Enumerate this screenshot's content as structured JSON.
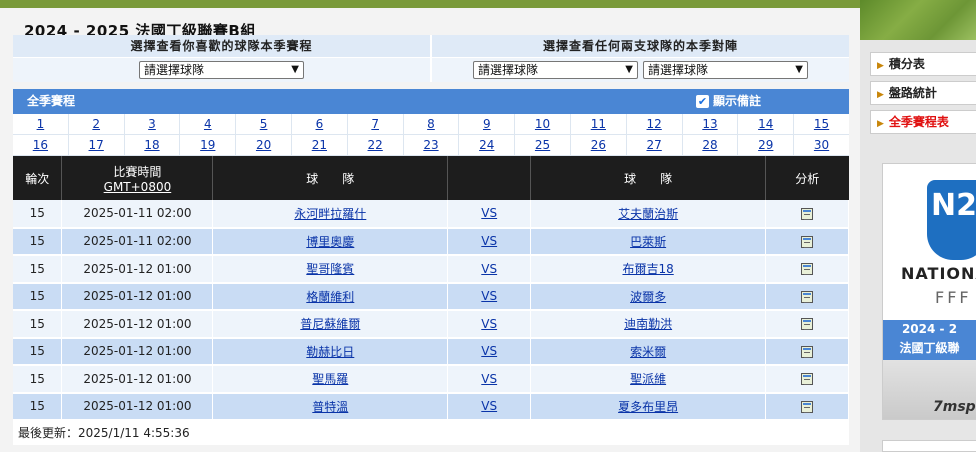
{
  "title": "2024 - 2025 法國丁級聯賽B組",
  "selectors": {
    "team_schedule_heading": "選擇查看你喜歡的球隊本季賽程",
    "matchup_heading": "選擇查看任何兩支球隊的本季對陣",
    "placeholder": "請選擇球隊"
  },
  "season": {
    "label": "全季賽程",
    "show_notes_label": "顯示備註",
    "show_notes_checked": true
  },
  "rounds_row1": [
    "1",
    "2",
    "3",
    "4",
    "5",
    "6",
    "7",
    "8",
    "9",
    "10",
    "11",
    "12",
    "13",
    "14",
    "15"
  ],
  "rounds_row2": [
    "16",
    "17",
    "18",
    "19",
    "20",
    "21",
    "22",
    "23",
    "24",
    "25",
    "26",
    "27",
    "28",
    "29",
    "30"
  ],
  "table": {
    "headers": {
      "round": "輪次",
      "time_line1": "比賽時間",
      "time_line2": "GMT+0800",
      "home": "球　　隊",
      "vs": "",
      "away": "球　　隊",
      "analysis": "分析"
    },
    "rows": [
      {
        "round": "15",
        "time": "2025-01-11 02:00",
        "home": "永河畔拉羅什",
        "vs": "VS",
        "away": "艾夫蘭治斯"
      },
      {
        "round": "15",
        "time": "2025-01-11 02:00",
        "home": "博里奧慶",
        "vs": "VS",
        "away": "巴萊斯"
      },
      {
        "round": "15",
        "time": "2025-01-12 01:00",
        "home": "聖哥隆賓",
        "vs": "VS",
        "away": "布爾吉18"
      },
      {
        "round": "15",
        "time": "2025-01-12 01:00",
        "home": "格蘭維利",
        "vs": "VS",
        "away": "波爾多"
      },
      {
        "round": "15",
        "time": "2025-01-12 01:00",
        "home": "普尼蘇維爾",
        "vs": "VS",
        "away": "迪南勤洪"
      },
      {
        "round": "15",
        "time": "2025-01-12 01:00",
        "home": "勒赫比日",
        "vs": "VS",
        "away": "索米爾"
      },
      {
        "round": "15",
        "time": "2025-01-12 01:00",
        "home": "聖馬羅",
        "vs": "VS",
        "away": "聖派維"
      },
      {
        "round": "15",
        "time": "2025-01-12 01:00",
        "home": "普特溫",
        "vs": "VS",
        "away": "夏多布里昂"
      }
    ]
  },
  "updated": "最後更新：2025/1/11 4:55:36",
  "sidebar": {
    "items": [
      {
        "label": "積分表"
      },
      {
        "label": "盤路統計"
      },
      {
        "label": "全季賽程表"
      }
    ],
    "promo": {
      "logo_text": "N2",
      "brand_line": "NATIONA",
      "fff": "FFF",
      "band_line1": "2024 - 2",
      "band_line2": "法國丁級聯",
      "site": "7msp"
    }
  }
}
